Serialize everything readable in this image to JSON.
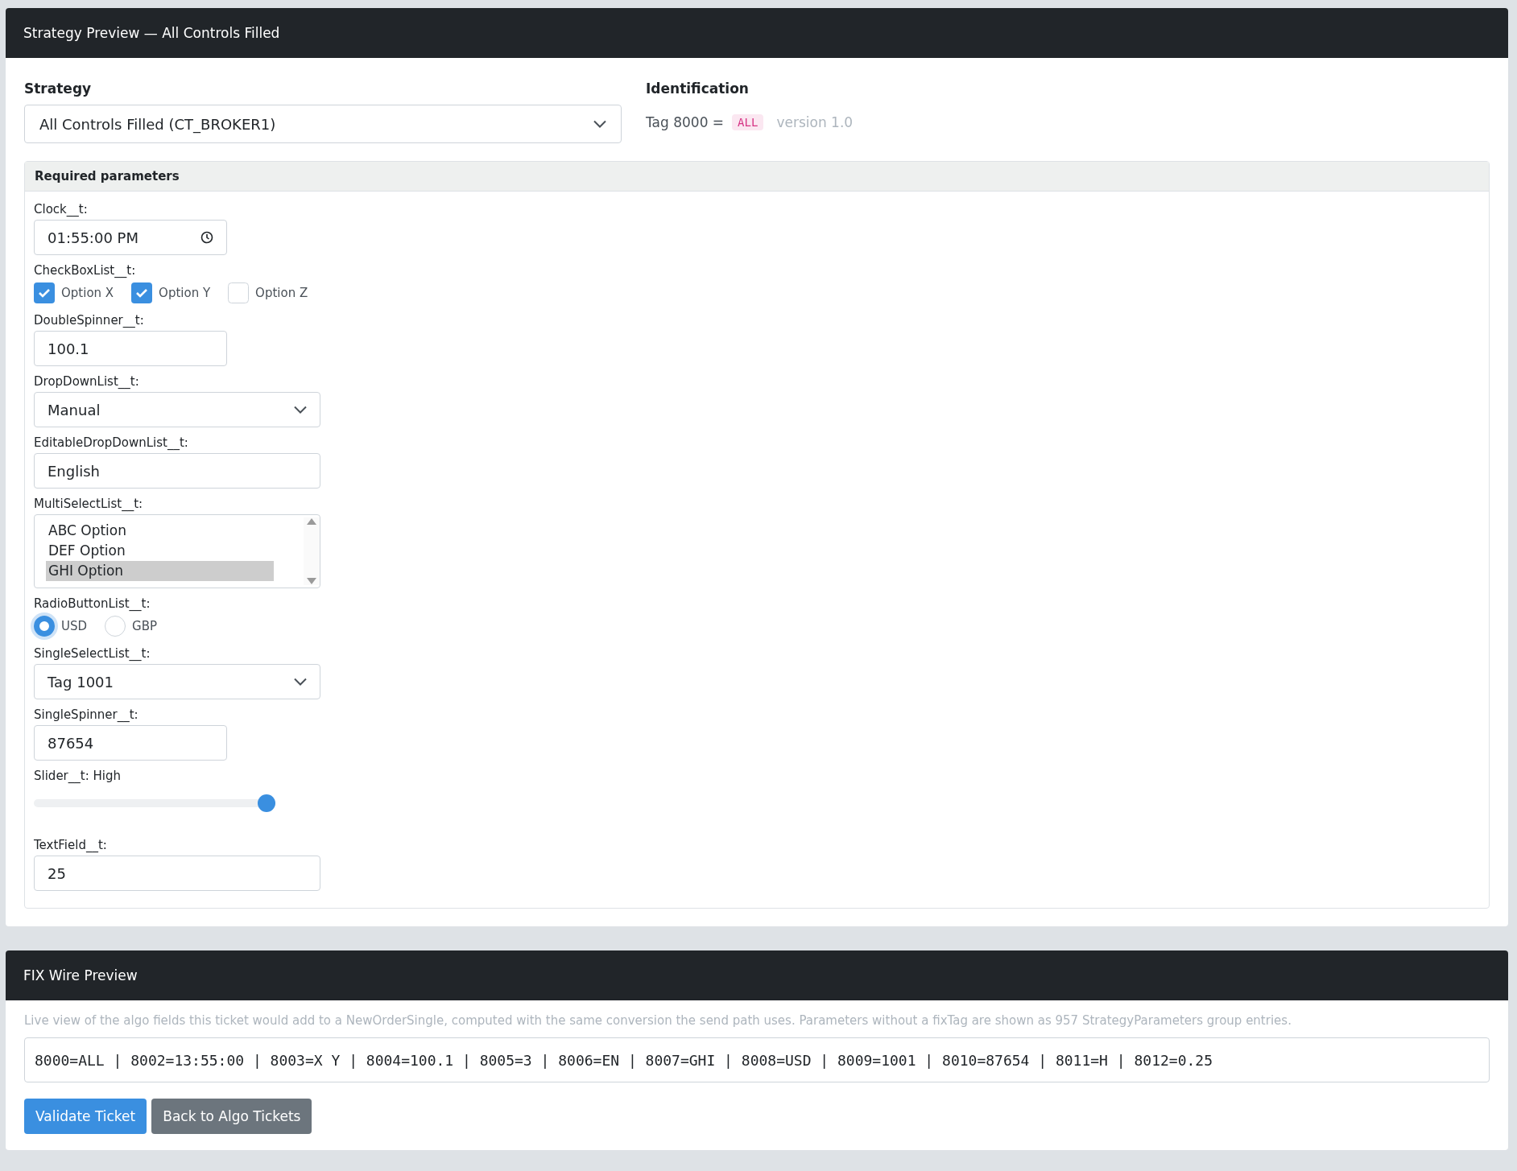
{
  "strategy_card": {
    "title": "Strategy Preview — All Controls Filled"
  },
  "strategy": {
    "label": "Strategy",
    "value": "All Controls Filled (CT_BROKER1)"
  },
  "identification": {
    "heading": "Identification",
    "tag_label": "Tag 8000 =",
    "tag_value": "ALL",
    "version": "version 1.0"
  },
  "parameters": {
    "heading": "Required parameters",
    "fields": [
      {
        "kind": "time",
        "label": "Clock__t:",
        "value": "01:55:00 PM"
      },
      {
        "kind": "checkboxes",
        "label": "CheckBoxList__t:",
        "options": [
          {
            "label": "Option X",
            "checked": true
          },
          {
            "label": "Option Y",
            "checked": true
          },
          {
            "label": "Option Z",
            "checked": false
          }
        ]
      },
      {
        "kind": "spinner",
        "label": "DoubleSpinner__t:",
        "value": "100.1"
      },
      {
        "kind": "dropdown",
        "label": "DropDownList__t:",
        "value": "Manual"
      },
      {
        "kind": "text",
        "label": "EditableDropDownList__t:",
        "value": "English"
      },
      {
        "kind": "listbox",
        "label": "MultiSelectList__t:",
        "options": [
          {
            "label": "ABC Option",
            "selected": false
          },
          {
            "label": "DEF Option",
            "selected": false
          },
          {
            "label": "GHI Option",
            "selected": true
          }
        ]
      },
      {
        "kind": "radios",
        "label": "RadioButtonList__t:",
        "options": [
          {
            "label": "USD",
            "selected": true
          },
          {
            "label": "GBP",
            "selected": false
          }
        ]
      },
      {
        "kind": "dropdown",
        "label": "SingleSelectList__t:",
        "value": "Tag 1001"
      },
      {
        "kind": "spinner",
        "label": "SingleSpinner__t:",
        "value": "87654"
      },
      {
        "kind": "slider",
        "label": "Slider__t: High",
        "level": 1
      },
      {
        "kind": "text",
        "label": "TextField__t:",
        "value": "25"
      }
    ]
  },
  "fix_preview": {
    "title": "FIX Wire Preview",
    "description": "Live view of the algo fields this ticket would add to a NewOrderSingle, computed with the same conversion the send path uses. Parameters without a fixTag are shown as 957 StrategyParameters group entries.",
    "wire": "8000=ALL | 8002=13:55:00 | 8003=X Y | 8004=100.1 | 8005=3 | 8006=EN | 8007=GHI | 8008=USD | 8009=1001 | 8010=87654 | 8011=H | 8012=0.25",
    "buttons": [
      {
        "label": "Validate Ticket",
        "kind": "primary"
      },
      {
        "label": "Back to Algo Tickets",
        "kind": "secondary"
      }
    ]
  }
}
